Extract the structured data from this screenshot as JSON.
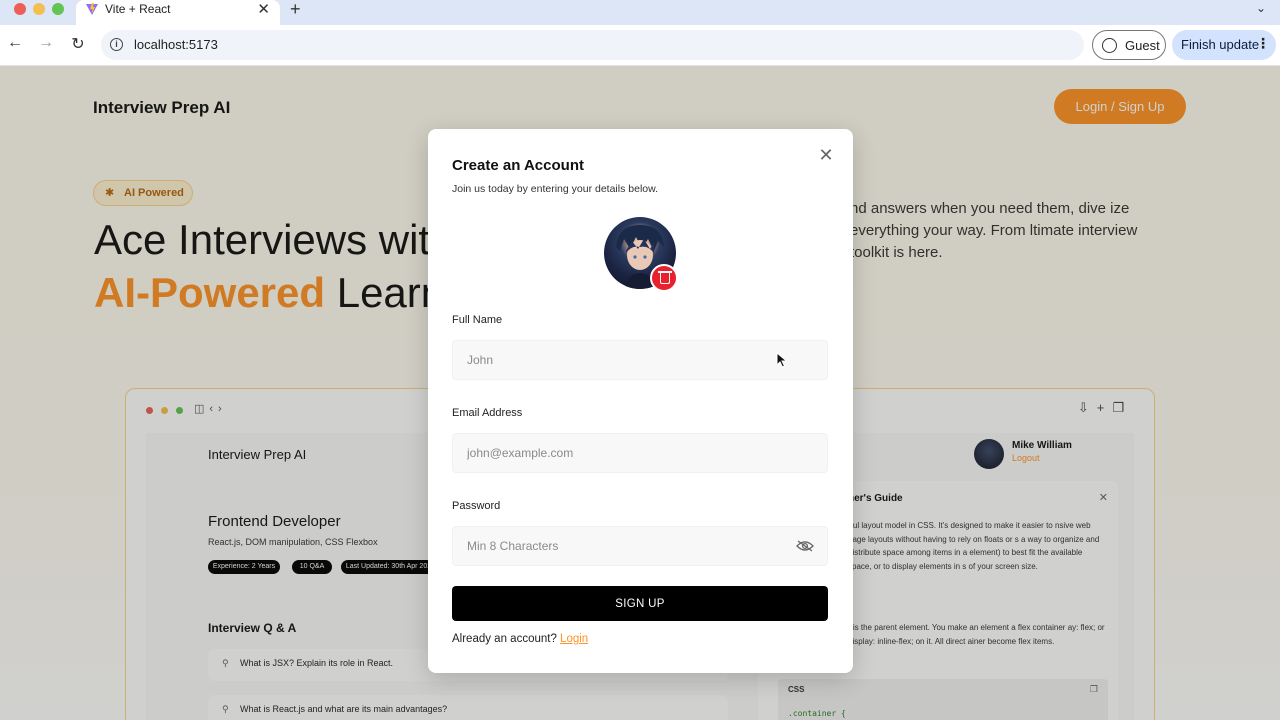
{
  "browser": {
    "tab_title": "Vite + React",
    "tab_close": "✕",
    "new_tab": "+",
    "url": "localhost:5173",
    "guest_label": "Guest",
    "finish_update_label": "Finish update",
    "icons": [
      "vite-logo-icon",
      "back-arrow-icon",
      "forward-arrow-icon",
      "reload-icon",
      "info-icon",
      "person-icon",
      "kebab-menu-icon",
      "chevron-down-icon"
    ]
  },
  "page": {
    "brand": "Interview Prep AI",
    "login_signup": "Login / Sign Up",
    "badge": "AI Powered",
    "hero_line1": "Ace Interviews wit",
    "hero_accent": "AI-Powered",
    "hero_line2_rest": " Learn",
    "hero_desc": "nd answers when you need them, dive ize everything your way. From ltimate interview toolkit is here.",
    "preview": {
      "brand": "Interview Prep AI",
      "user_name": "Mike William",
      "logout": "Logout",
      "role": "Frontend Developer",
      "topics": "React.js, DOM manipulation, CSS Flexbox",
      "pills": [
        "Experience: 2 Years",
        "10 Q&A",
        "Last Updated: 30th Apr 202"
      ],
      "qa_heading": "Interview Q & A",
      "questions": [
        "What is JSX? Explain its role in React.",
        "What is React.js and what are its main advantages?"
      ],
      "guide_title": "ner's Guide",
      "guide_text": "rful layout model in CSS. It's designed to make it easier to nsive web page layouts without having to rely on floats or s a way to organize and distribute space among items in a element) to best fit the available space, or to display elements in s of your screen size.",
      "guide_text2": "r is the parent element. You make an element a flex container ay: flex; or display: inline-flex; on it. All direct ainer become flex items.",
      "code_label": "CSS",
      "code_line": ".container {"
    }
  },
  "modal": {
    "title": "Create an Account",
    "subtitle": "Join us today by entering your details below.",
    "full_name_label": "Full Name",
    "full_name_placeholder": "John",
    "email_label": "Email Address",
    "email_placeholder": "john@example.com",
    "password_label": "Password",
    "password_placeholder": "Min 8 Characters",
    "submit_label": "SIGN UP",
    "have_account_text": "Already an account? ",
    "login_link": "Login"
  },
  "colors": {
    "accent": "#ff9324",
    "delete": "#e8212e",
    "button": "#000000"
  }
}
